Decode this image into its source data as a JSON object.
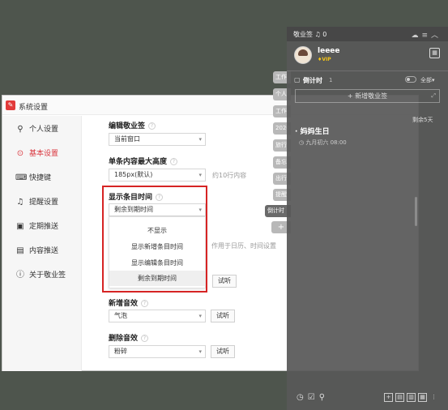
{
  "settings_window": {
    "title": "系统设置",
    "nav": [
      {
        "label": "个人设置",
        "icon": "user-icon"
      },
      {
        "label": "基本设置",
        "icon": "gear-icon"
      },
      {
        "label": "快捷键",
        "icon": "keyboard-icon"
      },
      {
        "label": "提醒设置",
        "icon": "bell-icon"
      },
      {
        "label": "定期推送",
        "icon": "calendar-push-icon"
      },
      {
        "label": "内容推送",
        "icon": "document-icon"
      },
      {
        "label": "关于敬业签",
        "icon": "info-icon"
      }
    ],
    "active_nav": "基本设置",
    "sections": {
      "edit_note": {
        "label": "编辑敬业签",
        "value": "当前窗口"
      },
      "max_height": {
        "label": "单条内容最大高度",
        "value": "185px(默认)",
        "hint": "约10行内容"
      },
      "show_time": {
        "label": "显示条目时间",
        "value": "剩余到期时间",
        "hint": "作用于日历、时间设置"
      },
      "new_sound": {
        "label": "新增音效",
        "value": "气泡",
        "test_label": "试听"
      },
      "delete_sound": {
        "label": "删除音效",
        "value": "粉碎",
        "test_label": "试听"
      },
      "extra_test_label": "试听"
    },
    "dropdown_options": [
      "不显示",
      "显示新增条目时间",
      "显示编辑条目时间",
      "剩余到期时间"
    ],
    "dropdown_selected": "剩余到期时间"
  },
  "side_tabs": [
    "工作",
    "个人",
    "工作",
    "2020",
    "旅行",
    "备忘",
    "出行",
    "提醒",
    "倒计时",
    "+"
  ],
  "panel": {
    "title": "敬业签",
    "badge": "0",
    "username": "leeee",
    "vip": "VIP",
    "countdown_label": "倒计时",
    "countdown_count": "1",
    "filter": "全部",
    "new_note": "+ 新增敬业签",
    "remaining": "剩余5天",
    "event_name": "妈妈生日",
    "event_date": "九月初六 08:00"
  },
  "colors": {
    "accent": "#d9363e",
    "highlight_border": "#d62424"
  }
}
